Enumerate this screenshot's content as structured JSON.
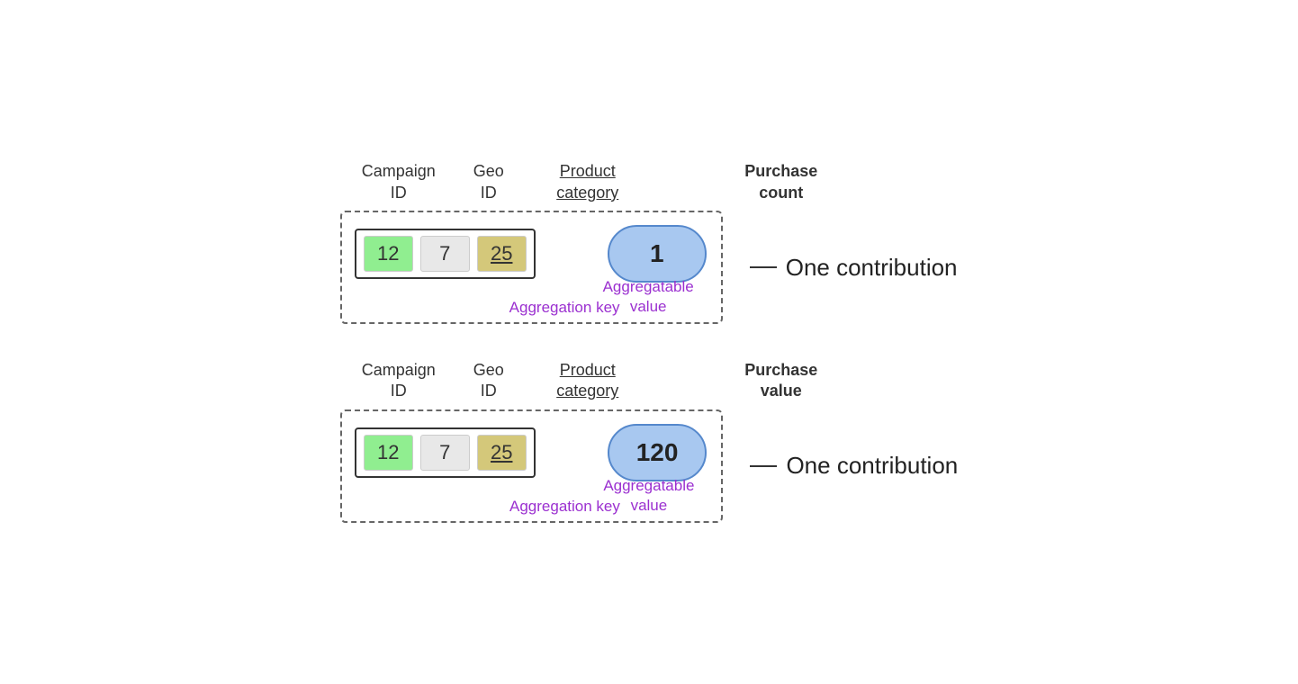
{
  "diagram": {
    "block1": {
      "headers": {
        "campaign": "Campaign\nID",
        "geo": "Geo\nID",
        "product": "Product\ncategory",
        "purchase": "Purchase\ncount"
      },
      "key": {
        "campaign_val": "12",
        "geo_val": "7",
        "product_val": "25"
      },
      "aggregatable_value": "1",
      "aggregation_key_label": "Aggregation key",
      "aggregatable_value_label": "Aggregatable\nvalue",
      "contribution_label": "One contribution"
    },
    "block2": {
      "headers": {
        "campaign": "Campaign\nID",
        "geo": "Geo\nID",
        "product": "Product\ncategory",
        "purchase": "Purchase\nvalue"
      },
      "key": {
        "campaign_val": "12",
        "geo_val": "7",
        "product_val": "25"
      },
      "aggregatable_value": "120",
      "aggregation_key_label": "Aggregation key",
      "aggregatable_value_label": "Aggregatable\nvalue",
      "contribution_label": "One contribution"
    }
  }
}
